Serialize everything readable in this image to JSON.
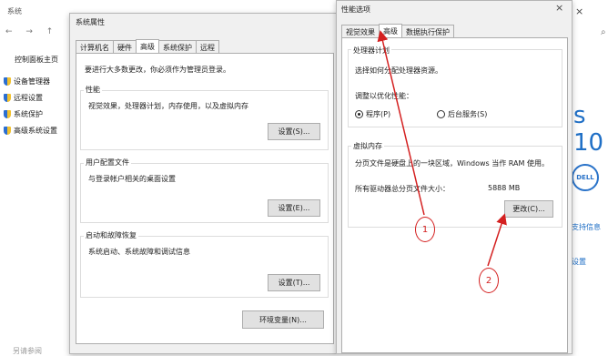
{
  "background_window": {
    "title": "系统",
    "nav_controls": "← → ↑",
    "home_link": "控制面板主页",
    "sidebar_items": [
      {
        "label": "设备管理器"
      },
      {
        "label": "远程设置"
      },
      {
        "label": "系统保护"
      },
      {
        "label": "高级系统设置"
      }
    ],
    "bottom_text": "另请参阅"
  },
  "right_strip": {
    "close_glyph": "×",
    "windows_text": "s 10",
    "dell_logo": "DELL",
    "support_link": "支持信息",
    "settings_link": "设置"
  },
  "system_properties": {
    "title": "系统属性",
    "tabs": [
      {
        "label": "计算机名"
      },
      {
        "label": "硬件"
      },
      {
        "label": "高级"
      },
      {
        "label": "系统保护"
      },
      {
        "label": "远程"
      }
    ],
    "admin_note": "要进行大多数更改，你必须作为管理员登录。",
    "performance": {
      "label": "性能",
      "description": "视觉效果，处理器计划，内存使用，以及虚拟内存",
      "button": "设置(S)..."
    },
    "user_profiles": {
      "label": "用户配置文件",
      "description": "与登录帐户相关的桌面设置",
      "button": "设置(E)..."
    },
    "startup_recovery": {
      "label": "启动和故障恢复",
      "description": "系统启动、系统故障和调试信息",
      "button": "设置(T)..."
    },
    "env_button": "环境变量(N)..."
  },
  "performance_options": {
    "title": "性能选项",
    "close_glyph": "×",
    "tabs": [
      {
        "label": "视觉效果"
      },
      {
        "label": "高级"
      },
      {
        "label": "数据执行保护"
      }
    ],
    "processor": {
      "label": "处理器计划",
      "description": "选择如何分配处理器资源。",
      "optimize_label": "调整以优化性能：",
      "option_programs": "程序(P)",
      "option_services": "后台服务(S)",
      "selected": "programs"
    },
    "virtual_memory": {
      "label": "虚拟内存",
      "description": "分页文件是硬盘上的一块区域，Windows 当作 RAM 使用。",
      "total_label": "所有驱动器总分页文件大小：",
      "total_value": "5888 MB",
      "change_button": "更改(C)..."
    }
  },
  "annotations": [
    {
      "label": "1"
    },
    {
      "label": "2"
    }
  ],
  "colors": {
    "annotation": "#d42020",
    "link": "#1f6fc6"
  }
}
